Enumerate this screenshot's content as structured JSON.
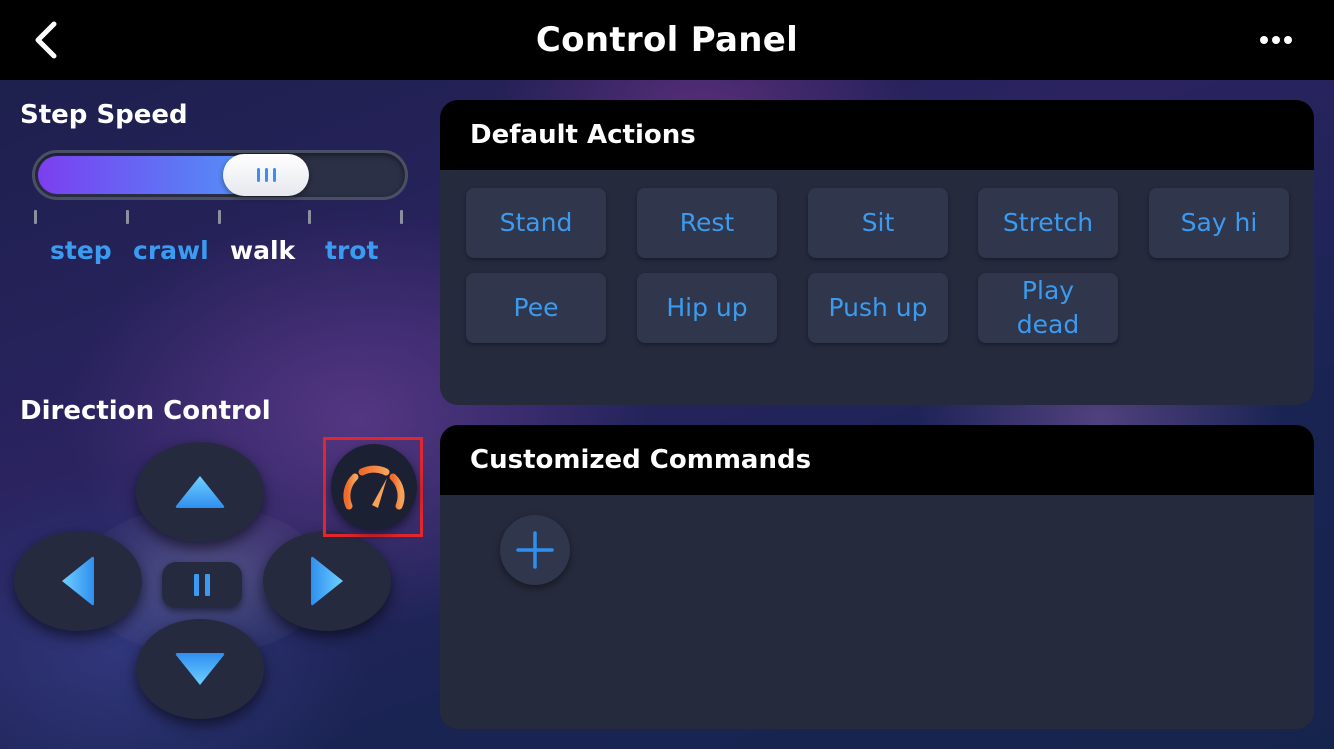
{
  "header": {
    "title": "Control Panel"
  },
  "step_speed": {
    "label": "Step Speed",
    "levels": [
      "step",
      "crawl",
      "walk",
      "trot"
    ],
    "selected": "walk"
  },
  "direction": {
    "label": "Direction Control"
  },
  "default_actions": {
    "title": "Default Actions",
    "buttons": [
      "Stand",
      "Rest",
      "Sit",
      "Stretch",
      "Say hi",
      "Pee",
      "Hip up",
      "Push up",
      "Play dead"
    ]
  },
  "custom_commands": {
    "title": "Customized Commands"
  },
  "colors": {
    "accent": "#3a9bf0",
    "header": "#000000",
    "panel": "#262a3d",
    "highlight_box": "#e3262b",
    "gauge": "#f08a3a"
  },
  "icons": {
    "back": "chevron-left-icon",
    "more": "more-horizontal-icon",
    "up": "triangle-up-icon",
    "down": "triangle-down-icon",
    "left": "triangle-left-icon",
    "right": "triangle-right-icon",
    "pause": "pause-icon",
    "speedometer": "speedometer-icon",
    "add": "plus-icon"
  }
}
